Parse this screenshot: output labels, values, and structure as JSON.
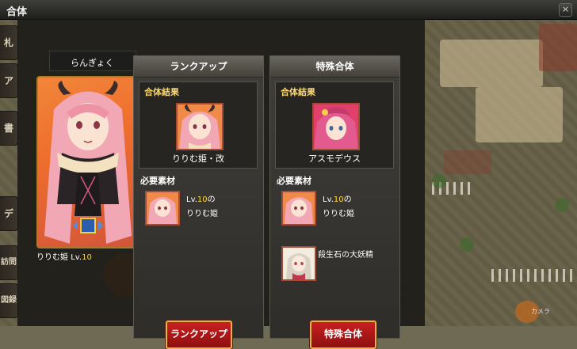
{
  "window": {
    "title": "合体",
    "close_icon": "×"
  },
  "side_tabs": [
    {
      "label": "札"
    },
    {
      "label": "アイ"
    },
    {
      "label": "書"
    },
    {
      "label": "デ"
    },
    {
      "label": "訪問"
    },
    {
      "label": "図録"
    }
  ],
  "selected_character": {
    "header_name": "らんぎょく",
    "name": "りりむ姫",
    "lv_prefix": "Lv.",
    "lv": "10"
  },
  "rankup": {
    "header": "ランクアップ",
    "result_label": "合体結果",
    "result_name": "りりむ姫・改",
    "required_label": "必要素材",
    "materials": [
      {
        "lv_prefix": "Lv.",
        "lv": "10",
        "lv_suffix": "の",
        "name": "りりむ姫"
      }
    ],
    "button_label": "ランクアップ"
  },
  "special": {
    "header": "特殊合体",
    "result_label": "合体結果",
    "result_name": "アスモデウス",
    "required_label": "必要素材",
    "materials": [
      {
        "lv_prefix": "Lv.",
        "lv": "10",
        "lv_suffix": "の",
        "name": "りりむ姫"
      },
      {
        "name": "殺生石の大妖精"
      }
    ],
    "button_label": "特殊合体"
  },
  "scene_labels": {
    "camera": "カメラ"
  },
  "colors": {
    "accent_gold": "#ffd96a",
    "button_red": "#c92020",
    "card_orange": "#f1863a"
  }
}
